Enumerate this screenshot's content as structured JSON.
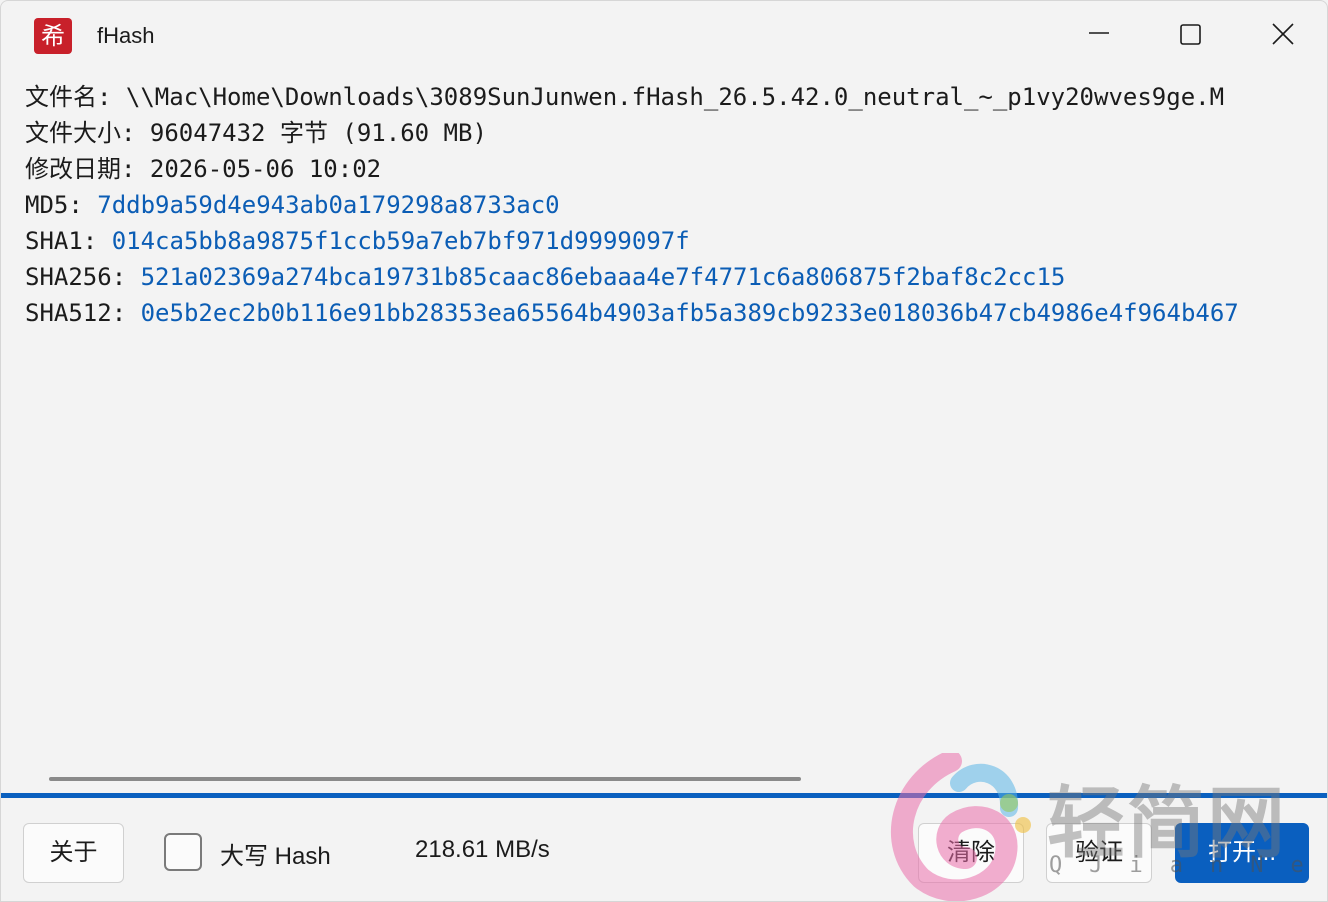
{
  "window": {
    "title": "fHash",
    "icon_glyph": "希"
  },
  "file_info": {
    "name_label": "文件名:",
    "name_value": "\\\\Mac\\Home\\Downloads\\3089SunJunwen.fHash_26.5.42.0_neutral_~_p1vy20wves9ge.M",
    "size_label": "文件大小:",
    "size_value": "96047432 字节 (91.60 MB)",
    "date_label": "修改日期:",
    "date_value": "2026-05-06 10:02",
    "md5_label": "MD5:",
    "md5_value": "7ddb9a59d4e943ab0a179298a8733ac0",
    "sha1_label": "SHA1:",
    "sha1_value": "014ca5bb8a9875f1ccb59a7eb7bf971d9999097f",
    "sha256_label": "SHA256:",
    "sha256_value": "521a02369a274bca19731b85caac86ebaaa4e7f4771c6a806875f2baf8c2cc15",
    "sha512_label": "SHA512:",
    "sha512_value": "0e5b2ec2b0b116e91bb28353ea65564b4903afb5a389cb9233e018036b47cb4986e4f964b467"
  },
  "progress": {
    "fraction": 1.0
  },
  "bottom": {
    "about_label": "关于",
    "uppercase_label": "大写 Hash",
    "uppercase_checked": false,
    "speed": "218.61 MB/s",
    "clear_label": "清除",
    "verify_label": "验证",
    "open_label": "打开..."
  },
  "watermark": {
    "text": "轻简网",
    "sub": "QJianNet"
  },
  "colors": {
    "accent": "#0a5fbf",
    "hash_text": "#0b5db5",
    "app_icon": "#c8202a"
  },
  "icons": [
    "app-logo-icon",
    "minimize-icon",
    "maximize-icon",
    "close-icon"
  ]
}
